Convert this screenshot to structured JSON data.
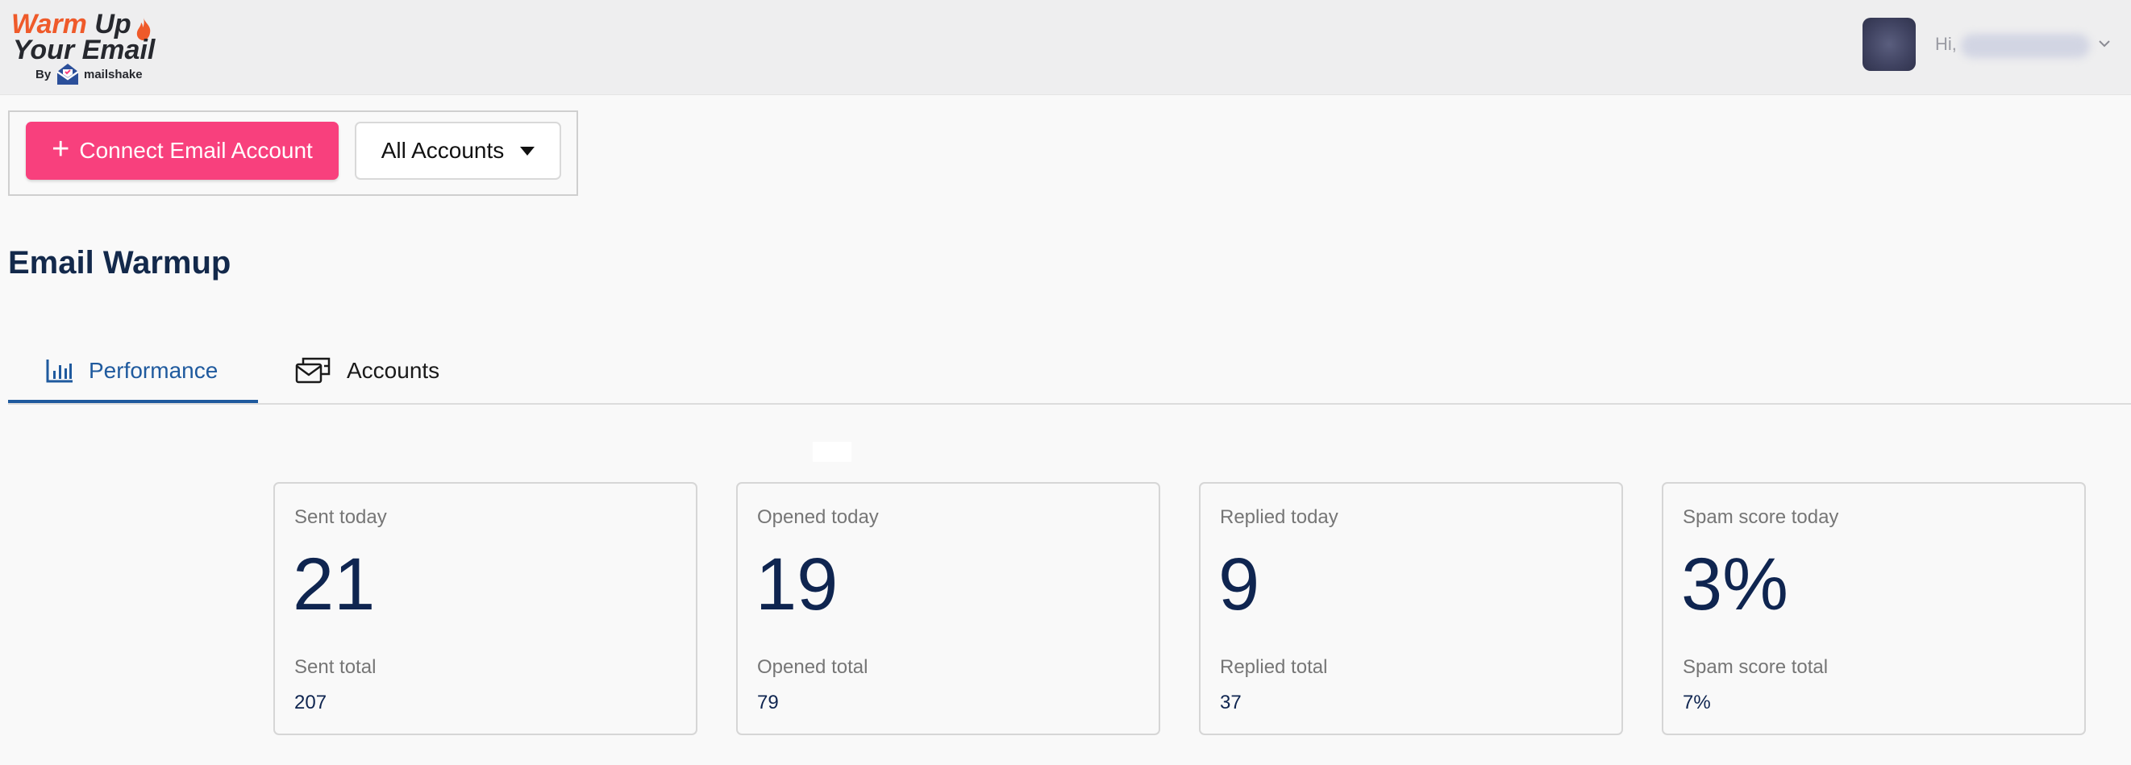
{
  "header": {
    "logo": {
      "line1_a": "Warm",
      "line1_b": "Up",
      "line2": "Your Email",
      "by": "By",
      "brand": "mailshake"
    },
    "greeting": "Hi,",
    "user_menu_icon": "chevron-down-icon"
  },
  "toolbar": {
    "connect_label": "Connect Email Account",
    "connect_icon": "plus-icon",
    "accounts_filter": "All Accounts"
  },
  "page": {
    "title": "Email Warmup"
  },
  "tabs": [
    {
      "label": "Performance",
      "icon": "bar-chart-icon",
      "active": true
    },
    {
      "label": "Accounts",
      "icon": "accounts-icon",
      "active": false
    }
  ],
  "stats": [
    {
      "label": "Sent today",
      "value": "21",
      "total_label": "Sent total",
      "total": "207"
    },
    {
      "label": "Opened today",
      "value": "19",
      "total_label": "Opened total",
      "total": "79"
    },
    {
      "label": "Replied today",
      "value": "9",
      "total_label": "Replied total",
      "total": "37"
    },
    {
      "label": "Spam score today",
      "value": "3%",
      "total_label": "Spam score total",
      "total": "7%"
    }
  ],
  "colors": {
    "accent_pink": "#f8407d",
    "tab_active": "#1f5a9e",
    "title_navy": "#13294b",
    "logo_orange": "#ef5a2a"
  }
}
